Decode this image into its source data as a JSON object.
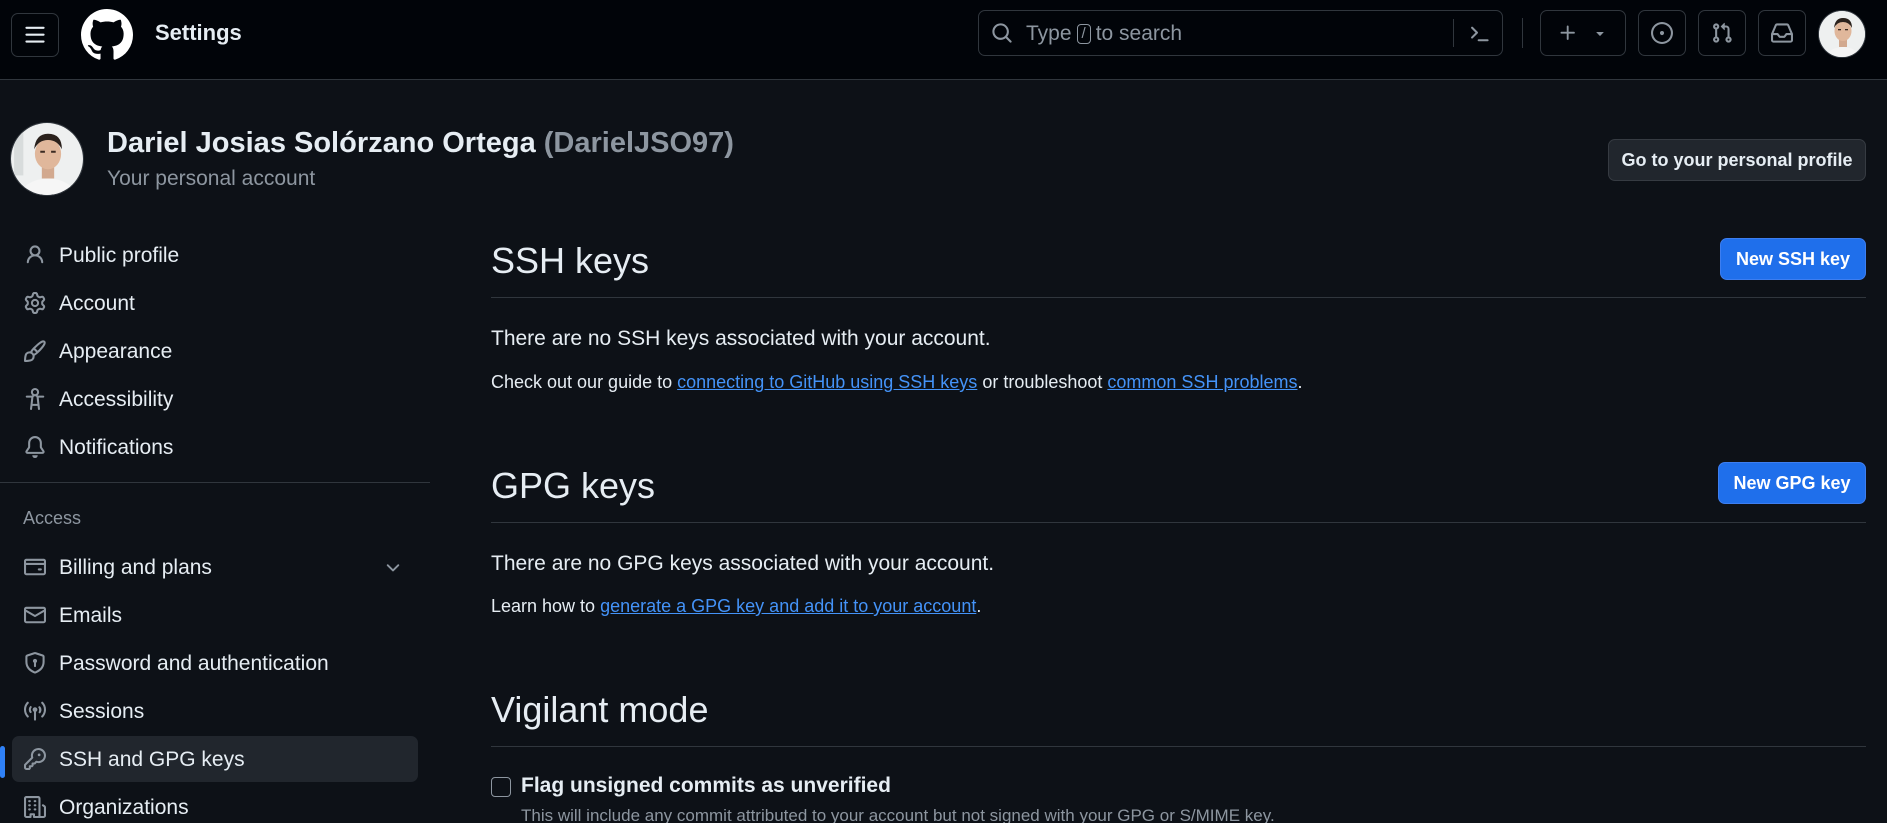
{
  "header": {
    "context_title": "Settings",
    "search": {
      "prefix": "Type",
      "key": "/",
      "suffix": "to search"
    },
    "icons": [
      "hamburger-icon",
      "github-logo-icon",
      "search-icon",
      "command-palette-icon",
      "plus-icon",
      "triangle-down-icon",
      "issue-icon",
      "pull-request-icon",
      "inbox-icon"
    ]
  },
  "account": {
    "name": "Dariel Josias Solórzano Ortega",
    "login": "(DarielJSO97)",
    "subtitle": "Your personal account",
    "profile_button": "Go to your personal profile"
  },
  "sidebar": {
    "items": [
      {
        "label": "Public profile",
        "icon": "person-icon"
      },
      {
        "label": "Account",
        "icon": "gear-icon"
      },
      {
        "label": "Appearance",
        "icon": "paintbrush-icon"
      },
      {
        "label": "Accessibility",
        "icon": "accessibility-icon"
      },
      {
        "label": "Notifications",
        "icon": "bell-icon"
      }
    ],
    "access_heading": "Access",
    "access_items": [
      {
        "label": "Billing and plans",
        "icon": "credit-card-icon"
      },
      {
        "label": "Emails",
        "icon": "mail-icon"
      },
      {
        "label": "Password and authentication",
        "icon": "shield-lock-icon"
      },
      {
        "label": "Sessions",
        "icon": "broadcast-icon"
      },
      {
        "label": "SSH and GPG keys",
        "icon": "key-icon",
        "active": true
      },
      {
        "label": "Organizations",
        "icon": "organization-icon"
      }
    ]
  },
  "ssh": {
    "title": "SSH keys",
    "new_button": "New SSH key",
    "empty": "There are no SSH keys associated with your account.",
    "guide_prefix": "Check out our guide to",
    "guide_link": "connecting to GitHub using SSH keys",
    "guide_middle": "or troubleshoot",
    "guide_link2": "common SSH problems",
    "guide_end": "."
  },
  "gpg": {
    "title": "GPG keys",
    "new_button": "New GPG key",
    "empty": "There are no GPG keys associated with your account.",
    "learn_prefix": "Learn how to",
    "learn_link": "generate a GPG key and add it to your account",
    "learn_end": "."
  },
  "vigilant": {
    "title": "Vigilant mode",
    "checkbox_label": "Flag unsigned commits as unverified",
    "checked": false,
    "note": "This will include any commit attributed to your account but not signed with your GPG or S/MIME key."
  },
  "colors": {
    "background": "#0d1117",
    "header_bg": "#010409",
    "accent": "#1f6feb",
    "link": "#4493f8",
    "muted": "#8d96a0"
  }
}
